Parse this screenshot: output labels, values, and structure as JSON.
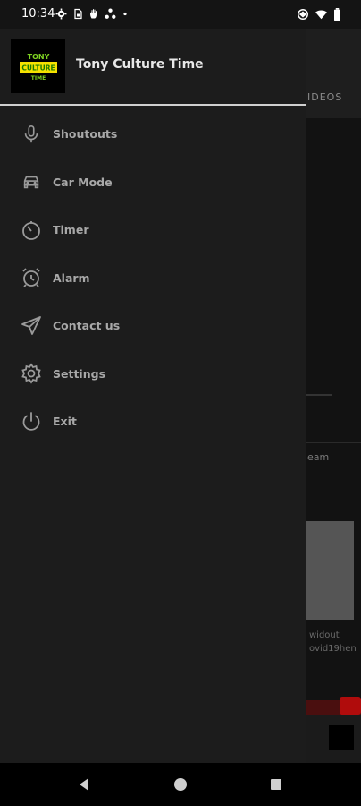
{
  "status_bar": {
    "time": "10:34",
    "left_icons": [
      "gear-icon",
      "sim-card-icon",
      "hand-icon",
      "share-nodes-icon",
      "dot-icon"
    ],
    "right_icons": [
      "data-saver-icon",
      "wifi-icon",
      "battery-icon"
    ]
  },
  "drawer": {
    "app_name": "Tony Culture Time",
    "logo_text": "TONY CULTURE TIME",
    "items": [
      {
        "label": "Shoutouts",
        "icon": "microphone-icon"
      },
      {
        "label": "Car Mode",
        "icon": "car-icon"
      },
      {
        "label": "Timer",
        "icon": "timer-icon"
      },
      {
        "label": "Alarm",
        "icon": "alarm-clock-icon"
      },
      {
        "label": "Contact us",
        "icon": "send-icon"
      },
      {
        "label": "Settings",
        "icon": "gear-icon"
      },
      {
        "label": "Exit",
        "icon": "power-icon"
      }
    ]
  },
  "background": {
    "tab_label": "IDEOS",
    "snippet_1": "eam",
    "snippet_2": "widout",
    "snippet_3": "ovid19hen"
  },
  "navigation_bar": {
    "buttons": [
      "back-icon",
      "home-icon",
      "recents-icon"
    ]
  },
  "colors": {
    "drawer_bg": "#1c1c1c",
    "menu_text": "#a8a8a8",
    "icon": "#9a9a9a",
    "logo_green": "#7ed321",
    "logo_yellow": "#f5e100"
  }
}
